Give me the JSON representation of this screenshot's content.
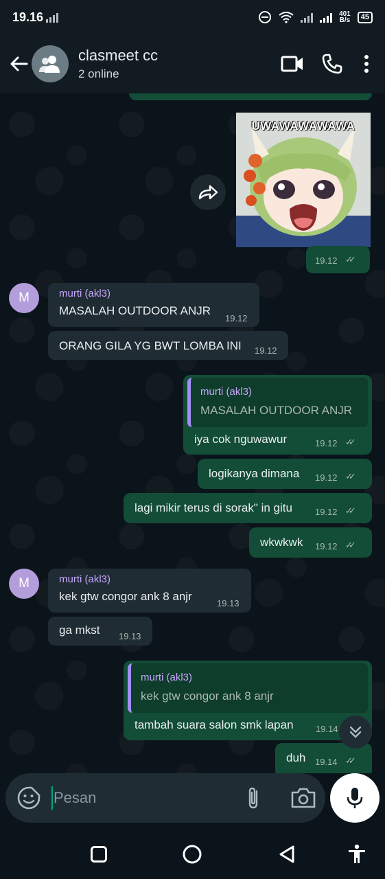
{
  "status_bar": {
    "time": "19.16",
    "net_speed_value": "401",
    "net_speed_unit": "B/s",
    "battery": "45"
  },
  "header": {
    "title": "clasmeet cc",
    "subtitle": "2 online",
    "icons": [
      "back-arrow-icon",
      "group-avatar-icon",
      "video-call-icon",
      "phone-call-icon",
      "more-menu-icon"
    ]
  },
  "messages": {
    "image": {
      "caption": "UWAWAWAWAWA",
      "time": "19.12"
    },
    "m1": {
      "avatar": "M",
      "sender": "murti (akl3)",
      "text": "MASALAH OUTDOOR ANJR",
      "time": "19.12"
    },
    "m2": {
      "text": "ORANG GILA YG BWT LOMBA INI",
      "time": "19.12"
    },
    "o1": {
      "quote_sender": "murti (akl3)",
      "quote_text": "MASALAH OUTDOOR ANJR",
      "text": "iya cok nguwawur",
      "time": "19.12"
    },
    "o2": {
      "text": "logikanya dimana",
      "time": "19.12"
    },
    "o3": {
      "text": "lagi mikir terus di sorak\" in gitu",
      "time": "19.12"
    },
    "o4": {
      "text": "wkwkwk",
      "time": "19.12"
    },
    "m3": {
      "avatar": "M",
      "sender": "murti (akl3)",
      "text": "kek gtw congor ank 8 anjr",
      "time": "19.13"
    },
    "m4": {
      "text": "ga mkst",
      "time": "19.13"
    },
    "o5": {
      "quote_sender": "murti (akl3)",
      "quote_text": "kek gtw congor ank 8 anjr",
      "text": "tambah suara salon smk lapan",
      "time": "19.14"
    },
    "o6": {
      "text": "duh",
      "time": "19.14"
    }
  },
  "input": {
    "placeholder": "Pesan",
    "value": ""
  },
  "colors": {
    "background": "#0b141a",
    "incoming_bubble": "#202c33",
    "outgoing_bubble": "#134d37",
    "sender_name": "#c7a6ff",
    "avatar_m": "#b39ddb"
  }
}
